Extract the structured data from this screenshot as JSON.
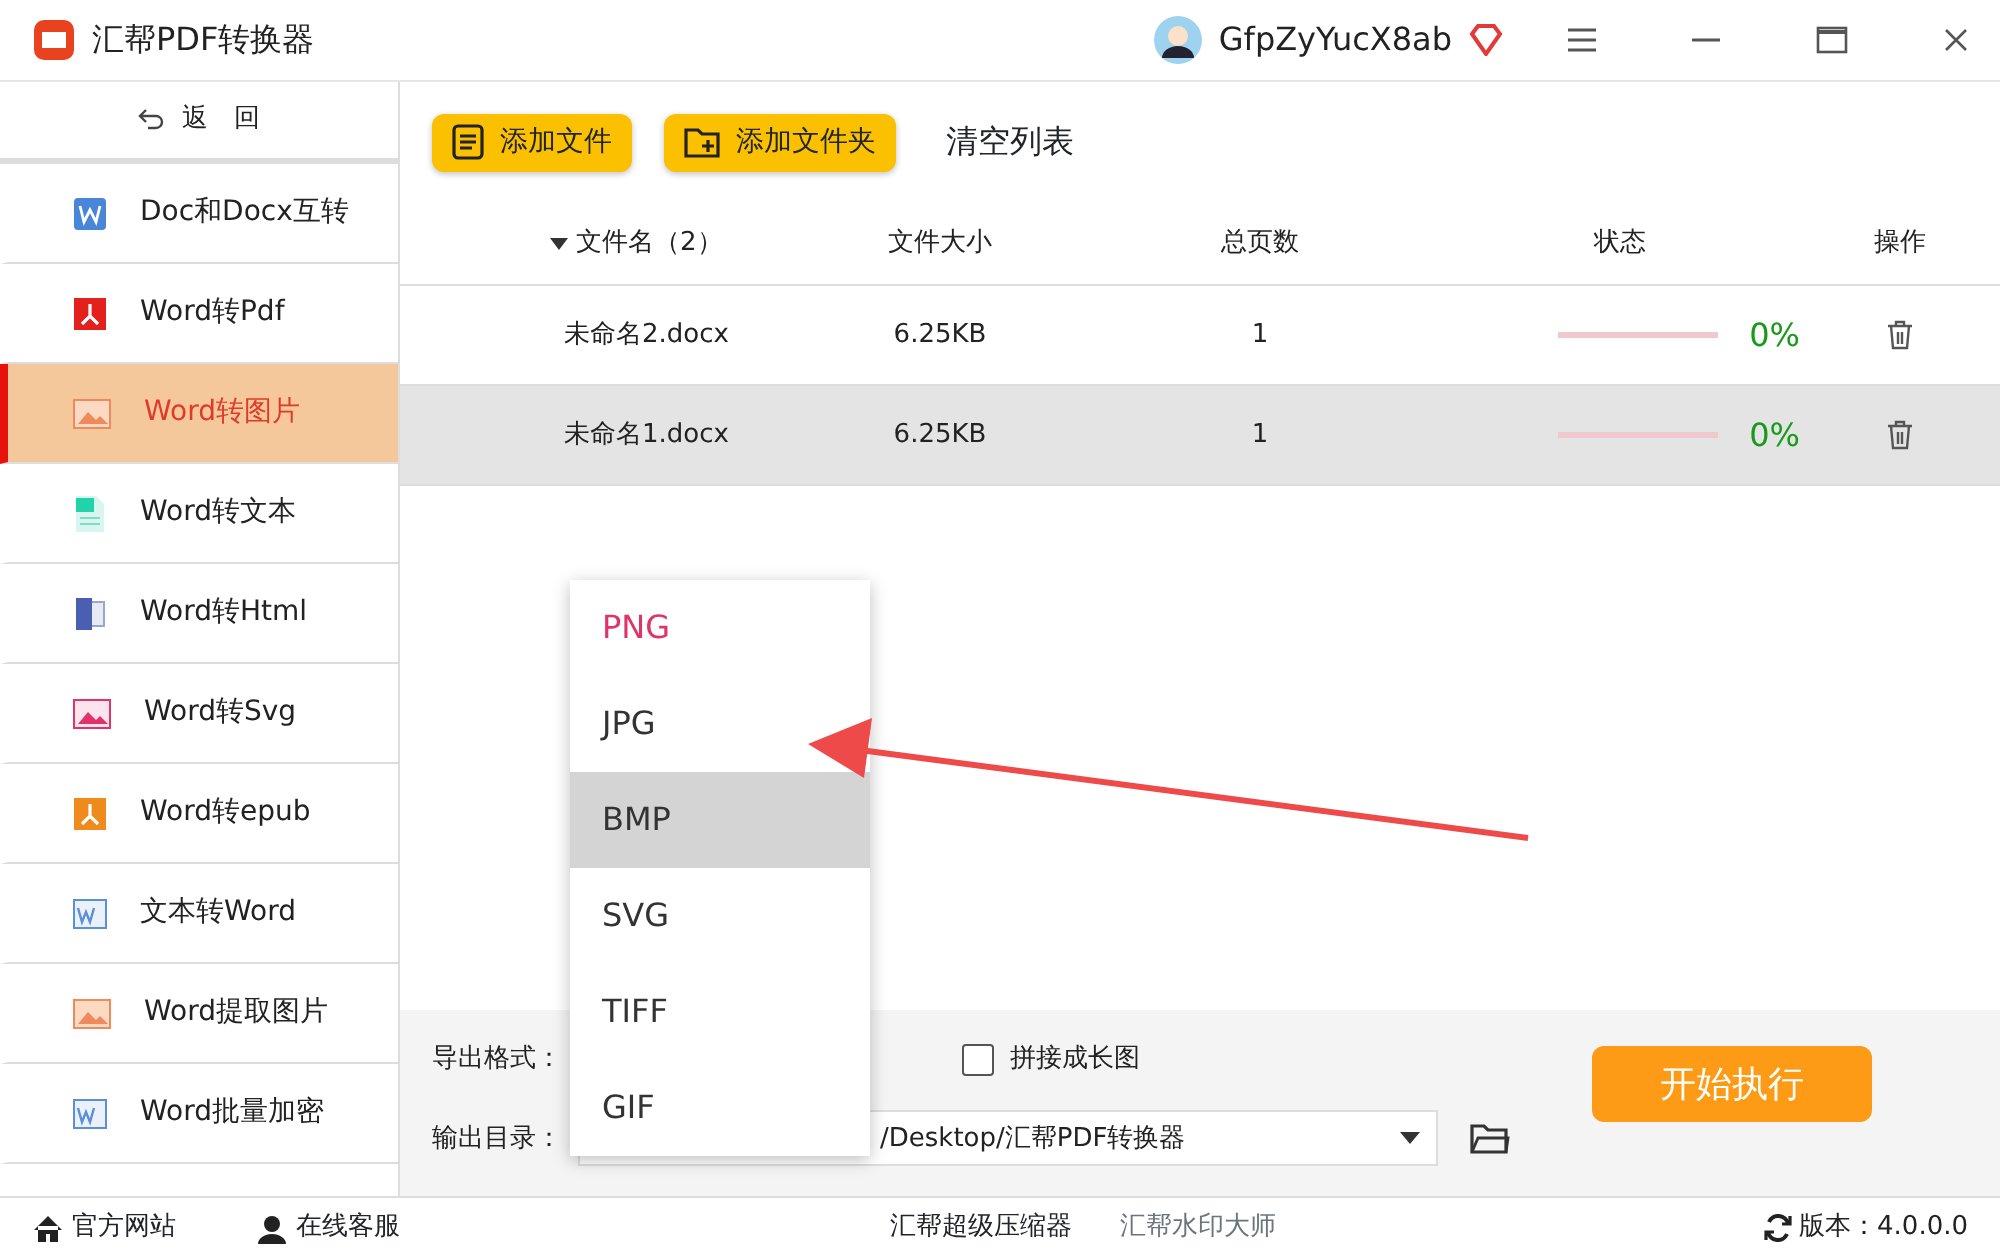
{
  "window": {
    "title": "汇帮PDF转换器",
    "user": "GfpZyYucX8ab"
  },
  "sidebar": {
    "back": "返　回",
    "items": [
      {
        "label": "Doc和Docx互转",
        "kind": "word",
        "selected": false
      },
      {
        "label": "Word转Pdf",
        "kind": "pdf",
        "selected": false
      },
      {
        "label": "Word转图片",
        "kind": "image",
        "selected": true
      },
      {
        "label": "Word转文本",
        "kind": "text",
        "selected": false
      },
      {
        "label": "Word转Html",
        "kind": "html",
        "selected": false
      },
      {
        "label": "Word转Svg",
        "kind": "svg",
        "selected": false
      },
      {
        "label": "Word转epub",
        "kind": "epub",
        "selected": false
      },
      {
        "label": "文本转Word",
        "kind": "wordfile",
        "selected": false
      },
      {
        "label": "Word提取图片",
        "kind": "image",
        "selected": false
      },
      {
        "label": "Word批量加密",
        "kind": "wordfile",
        "selected": false
      }
    ]
  },
  "toolbar": {
    "add_file": "添加文件",
    "add_folder": "添加文件夹",
    "clear": "清空列表"
  },
  "table": {
    "columns": [
      "文件名（2）",
      "文件大小",
      "总页数",
      "状态",
      "操作"
    ],
    "rows": [
      {
        "name": "未命名2.docx",
        "size": "6.25KB",
        "pages": "1",
        "level": 0,
        "percent": "0%",
        "selected": false
      },
      {
        "name": "未命名1.docx",
        "size": "6.25KB",
        "pages": "1",
        "level": 0,
        "percent": "0%",
        "selected": true
      }
    ]
  },
  "options": {
    "format_label": "导出格式：",
    "merge_label": "拼接成长图",
    "merge_checked": false,
    "dir_label": "输出目录：",
    "dir_value": "/Desktop/汇帮PDF转换器",
    "start": "开始执行"
  },
  "format_menu": [
    {
      "label": "PNG",
      "selected": true,
      "highlighted": false
    },
    {
      "label": "JPG",
      "selected": false,
      "highlighted": false
    },
    {
      "label": "BMP",
      "selected": false,
      "highlighted": true
    },
    {
      "label": "SVG",
      "selected": false,
      "highlighted": false
    },
    {
      "label": "TIFF",
      "selected": false,
      "highlighted": false
    },
    {
      "label": "GIF",
      "selected": false,
      "highlighted": false
    }
  ],
  "status_bar": {
    "website": "官方网站",
    "service": "在线客服",
    "app1": "汇帮超级压缩器",
    "app2": "汇帮水印大师",
    "version": "版本：4.0.0.0"
  }
}
